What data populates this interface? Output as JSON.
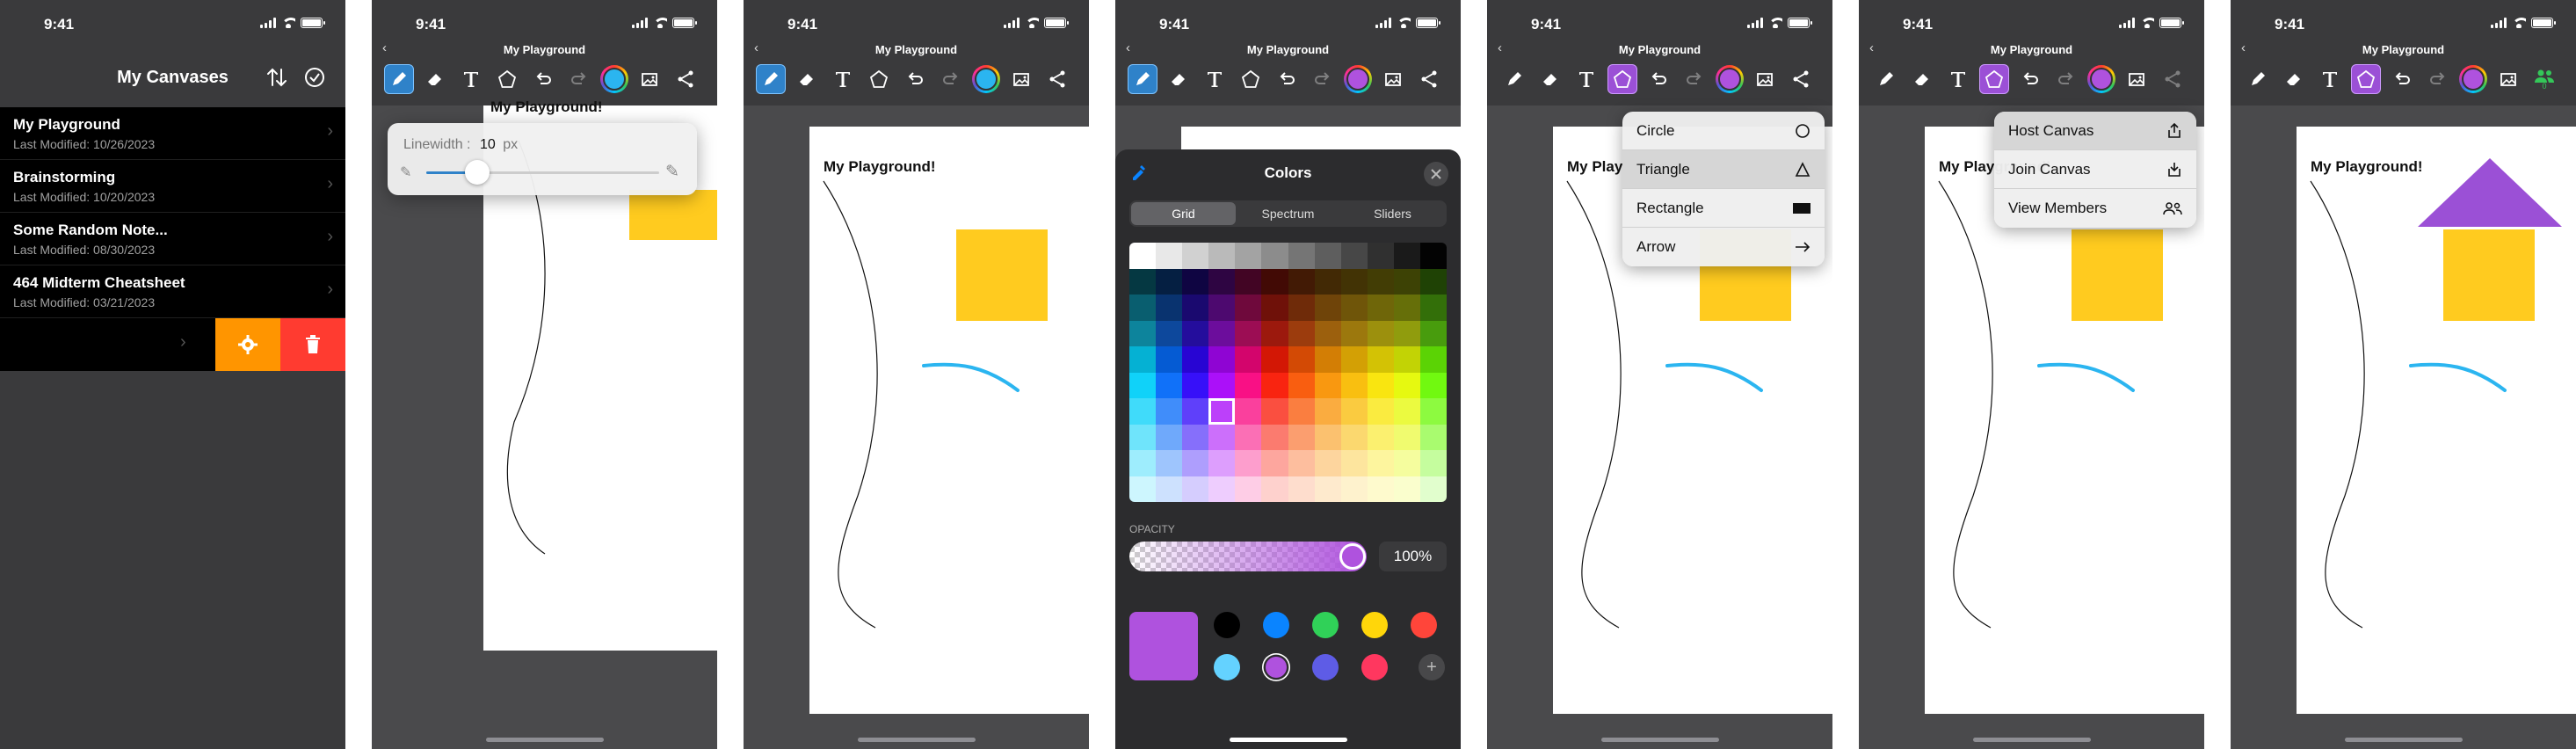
{
  "status": {
    "time": "9:41"
  },
  "list_screen": {
    "title": "My Canvases",
    "items": [
      {
        "name": "My Playground",
        "modified": "Last Modified: 10/26/2023"
      },
      {
        "name": "Brainstorming",
        "modified": "Last Modified: 10/20/2023"
      },
      {
        "name": "Some Random Note...",
        "modified": "Last Modified: 08/30/2023"
      },
      {
        "name": "464 Midterm Cheatsheet",
        "modified": "Last Modified: 03/21/2023"
      }
    ],
    "swipe_colors": {
      "settings": "#ff9500",
      "delete": "#ff3b30"
    }
  },
  "editor": {
    "canvas_title": "My Playground",
    "heading": "My Playground!",
    "accent_blue": "#2f82c9",
    "accent_purple": "#9b50d6",
    "shape_yellow": "#ffcb1f",
    "stroke_blue": "#2bb5f0"
  },
  "linewidth_popover": {
    "label": "Linewidth :",
    "value": "10",
    "unit": "px",
    "slider_fraction": 0.22
  },
  "colors_sheet": {
    "title": "Colors",
    "tabs": [
      "Grid",
      "Spectrum",
      "Sliders"
    ],
    "opacity_label": "OPACITY",
    "opacity_value": "100%",
    "selected_color": "#af52de",
    "swatches_row1": [
      "#000000",
      "#0a84ff",
      "#30d158",
      "#ffd60a",
      "#ff453a"
    ],
    "swatches_row2": [
      "#64d2ff",
      "#af52de",
      "#5e5ce6",
      "#ff375f"
    ]
  },
  "shape_menu": {
    "items": [
      {
        "label": "Circle",
        "icon": "circle-icon"
      },
      {
        "label": "Triangle",
        "icon": "triangle-icon"
      },
      {
        "label": "Rectangle",
        "icon": "rectangle-icon"
      },
      {
        "label": "Arrow",
        "icon": "arrow-icon"
      }
    ]
  },
  "share_menu": {
    "items": [
      {
        "label": "Host Canvas",
        "icon": "share-up-icon"
      },
      {
        "label": "Join Canvas",
        "icon": "tray-down-icon"
      },
      {
        "label": "View Members",
        "icon": "people-icon"
      }
    ]
  },
  "members_badge": {
    "count": "0"
  }
}
